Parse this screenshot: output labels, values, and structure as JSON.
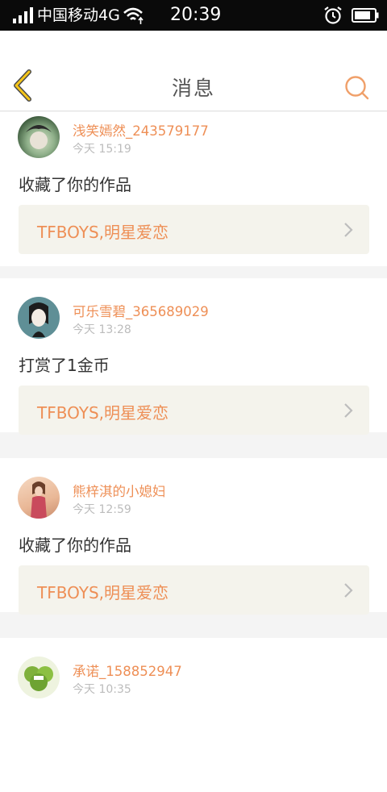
{
  "status_bar": {
    "carrier": "中国移动4G",
    "time": "20:39"
  },
  "header": {
    "title": "消息"
  },
  "messages": [
    {
      "user": "浅笑嫣然_243579177",
      "time": "今天 15:19",
      "action": "收藏了你的作品",
      "work": "TFBOYS,明星爱恋"
    },
    {
      "user": "可乐雪碧_365689029",
      "time": "今天 13:28",
      "action": "打赏了1金币",
      "work": "TFBOYS,明星爱恋"
    },
    {
      "user": "熊梓淇的小媳妇",
      "time": "今天 12:59",
      "action": "收藏了你的作品",
      "work": "TFBOYS,明星爱恋"
    },
    {
      "user": "承诺_158852947",
      "time": "今天 10:35"
    }
  ],
  "colors": {
    "accent": "#ee8f56",
    "back_arrow": "#f5c518"
  }
}
